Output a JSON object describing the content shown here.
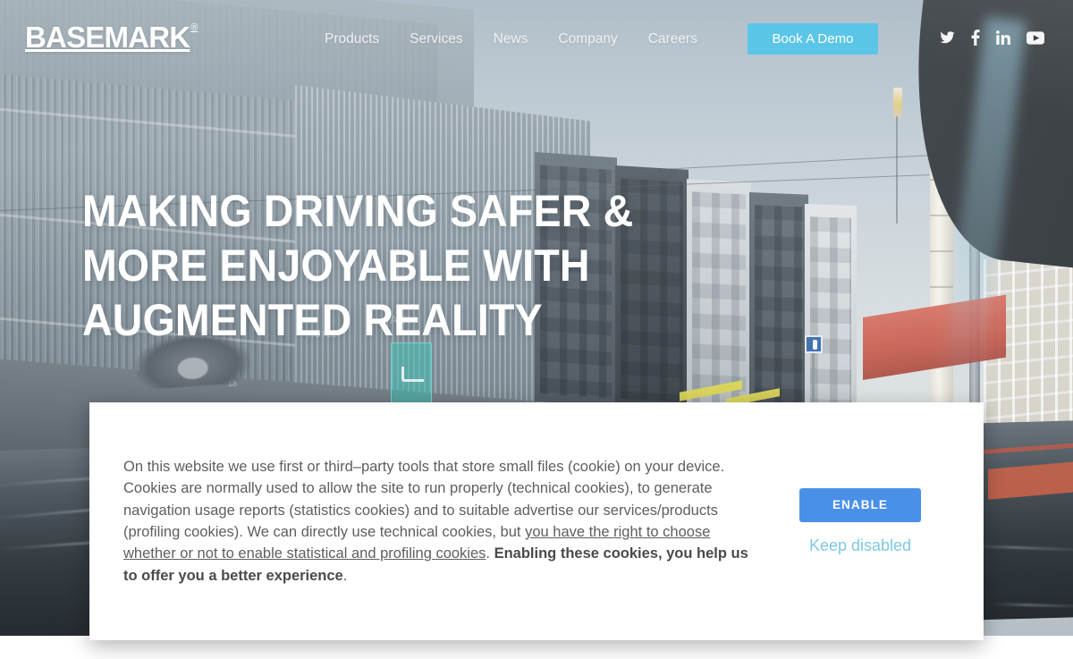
{
  "header": {
    "logo_text": "BASEMARK",
    "logo_registered": "®",
    "nav": [
      {
        "label": "Products"
      },
      {
        "label": "Services"
      },
      {
        "label": "News"
      },
      {
        "label": "Company"
      },
      {
        "label": "Careers"
      }
    ],
    "cta_label": "Book A Demo",
    "cta_color": "#5bc5e8",
    "socials": [
      {
        "name": "twitter-icon"
      },
      {
        "name": "facebook-icon"
      },
      {
        "name": "linkedin-icon"
      },
      {
        "name": "youtube-icon"
      }
    ]
  },
  "hero": {
    "headline": "Making driving safer & more enjoyable with augmented reality",
    "headline_color": "#ffffff"
  },
  "cookie_banner": {
    "paragraph_part1": "On this website we use first or third–party tools that store small files (cookie) on your device. Cookies are normally used to allow the site to run properly (technical cookies), to generate navigation usage reports (statistics cookies) and to suitable advertise our services/products (profiling cookies). We can directly use technical cookies, but ",
    "link_text": "you have the right to choose whether or not to enable statistical and profiling cookies",
    "paragraph_part2": ". ",
    "bold_text": "Enabling these cookies, you help us to offer you a better experience",
    "paragraph_part3": ".",
    "enable_label": "ENABLE",
    "keep_disabled_label": "Keep disabled",
    "enable_color": "#4a90e8",
    "keep_disabled_color": "#7ec8e3"
  }
}
